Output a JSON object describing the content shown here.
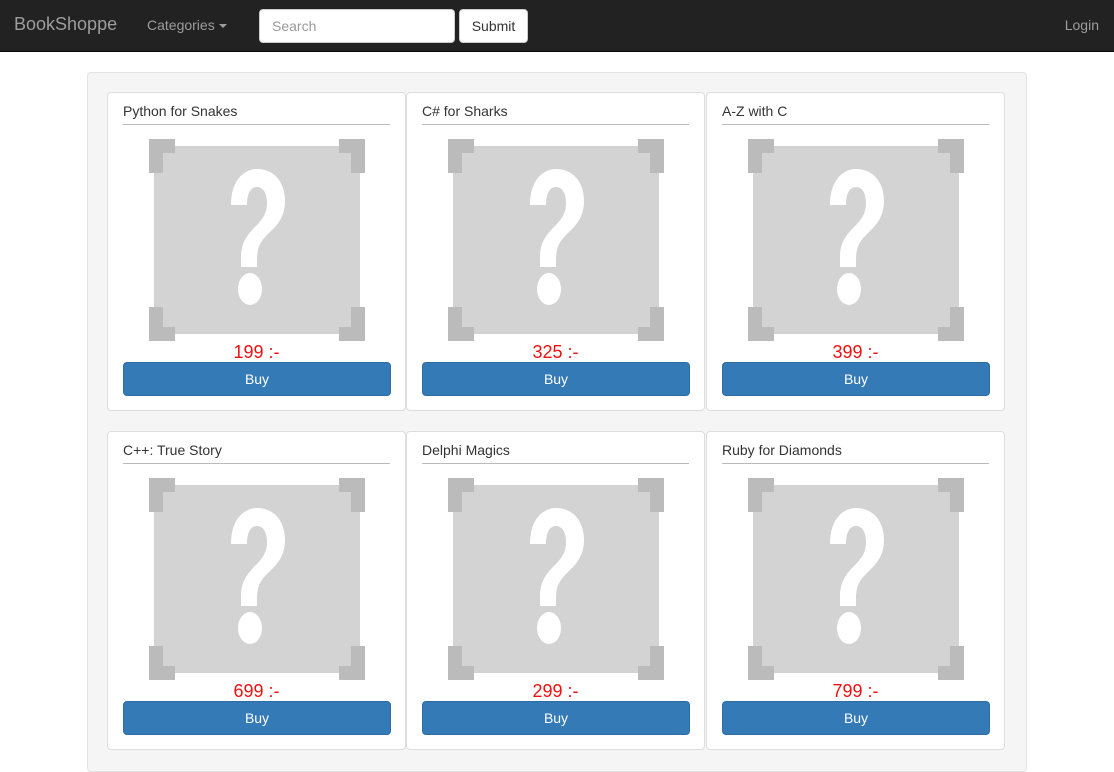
{
  "navbar": {
    "brand": "BookShoppe",
    "categories_label": "Categories",
    "search_placeholder": "Search",
    "search_value": "",
    "submit_label": "Submit",
    "login_label": "Login"
  },
  "products": [
    {
      "title": "Python for Snakes",
      "price": "199 :-",
      "buy_label": "Buy",
      "image": "placeholder-question-icon"
    },
    {
      "title": "C# for Sharks",
      "price": "325 :-",
      "buy_label": "Buy",
      "image": "placeholder-question-icon"
    },
    {
      "title": "A-Z with C",
      "price": "399 :-",
      "buy_label": "Buy",
      "image": "placeholder-question-icon"
    },
    {
      "title": "C++: True Story",
      "price": "699 :-",
      "buy_label": "Buy",
      "image": "placeholder-question-icon"
    },
    {
      "title": "Delphi Magics",
      "price": "299 :-",
      "buy_label": "Buy",
      "image": "placeholder-question-icon"
    },
    {
      "title": "Ruby for Diamonds",
      "price": "799 :-",
      "buy_label": "Buy",
      "image": "placeholder-question-icon"
    }
  ],
  "colors": {
    "navbar_bg": "#222222",
    "price": "#ee1111",
    "buy_button": "#337ab7",
    "placeholder_bg": "#d3d3d3",
    "placeholder_corner": "#bbbbbb"
  }
}
